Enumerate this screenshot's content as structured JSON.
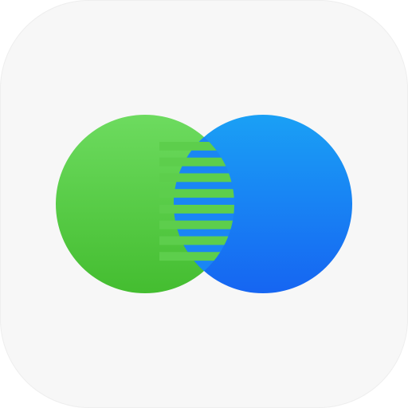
{
  "icon": {
    "kind": "app-icon",
    "symbol": "two-overlapping-circles-icon",
    "colors": {
      "tile_background": "#f7f7f7",
      "left_circle_top": "#6ddb5f",
      "left_circle_bottom": "#44bd30",
      "right_circle_top": "#1aa0f5",
      "right_circle_bottom": "#1665f2",
      "overlap_stripe_green": "#5dce4c",
      "overlap_stripe_blue": "#1a86f4"
    },
    "overlap_stripe_count": 8
  }
}
